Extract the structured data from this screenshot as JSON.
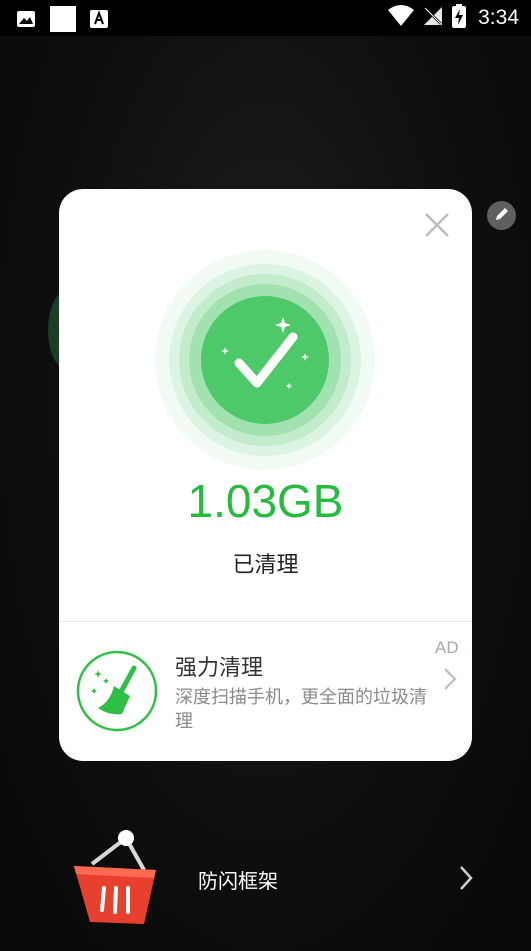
{
  "status_bar": {
    "time": "3:34",
    "icons": [
      "image-icon",
      "square-icon",
      "font-icon",
      "wifi-icon",
      "no-sim-icon",
      "battery-charging-icon"
    ]
  },
  "background": {
    "edit_icon": "pencil-icon",
    "feature_row": {
      "label": "防闪框架",
      "icon": "basket-icon"
    }
  },
  "dialog": {
    "close_icon": "close-icon",
    "check_icon": "checkmark-icon",
    "amount": "1.03GB",
    "status_text": "已清理",
    "ad": {
      "title": "强力清理",
      "description": "深度扫描手机，更全面的垃圾清理",
      "badge": "AD",
      "icon": "broom-icon"
    }
  },
  "colors": {
    "accent_green": "#25bb3c",
    "check_circle_green": "#4ec96a",
    "basket_red": "#e8402f"
  }
}
